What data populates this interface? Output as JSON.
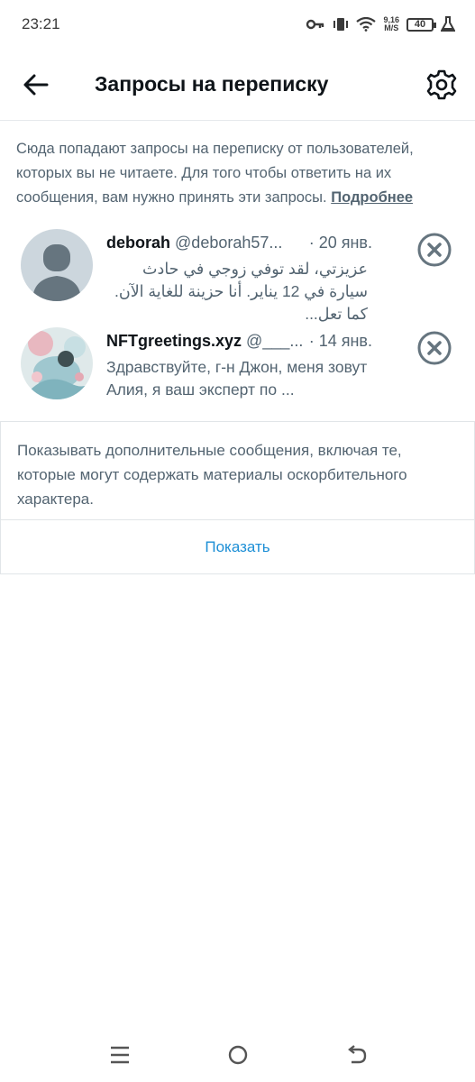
{
  "status_bar": {
    "time": "23:21",
    "net_speed_value": "9,16",
    "net_speed_unit": "M/S",
    "battery": "40"
  },
  "header": {
    "title": "Запросы на переписку"
  },
  "info": {
    "text": "Сюда попадают запросы на переписку от пользователей, которых вы не читаете. Для того чтобы ответить на их сообщения, вам нужно принять эти запросы. ",
    "link": "Подробнее"
  },
  "requests": [
    {
      "name": "deborah",
      "handle": "@deborah57...",
      "date": "· 20 янв.",
      "preview": "عزيزتي، لقد توفي زوجي في حادث سيارة في 12 يناير. أنا حزينة للغاية الآن. كما تعل..."
    },
    {
      "name": "NFTgreetings.xyz",
      "handle": "@___...",
      "date": "· 14 янв.",
      "preview": "Здравствуйте, г-н Джон, меня зовут Алия, я ваш эксперт по ..."
    }
  ],
  "more": {
    "text": "Показывать дополнительные сообщения, включая те, которые могут содержать материалы оскорбительного характера.",
    "button": "Показать"
  },
  "colors": {
    "accent": "#1d8fd6",
    "secondary_text": "#536471",
    "primary_text": "#0f1419"
  }
}
